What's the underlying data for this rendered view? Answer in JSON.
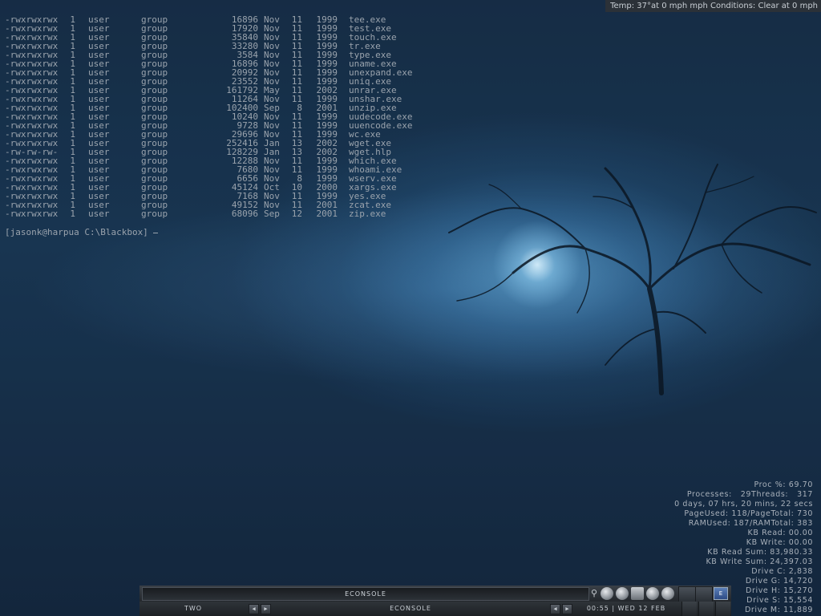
{
  "weather": {
    "text": "Temp: 37°at 0 mph mph Conditions: Clear at 0 mph"
  },
  "terminal": {
    "listing": [
      {
        "perm": "-rwxrwxrwx",
        "links": "1",
        "user": "user",
        "group": "group",
        "size": "16896",
        "month": "Nov",
        "day": "11",
        "year": "1999",
        "name": "tee.exe"
      },
      {
        "perm": "-rwxrwxrwx",
        "links": "1",
        "user": "user",
        "group": "group",
        "size": "17920",
        "month": "Nov",
        "day": "11",
        "year": "1999",
        "name": "test.exe"
      },
      {
        "perm": "-rwxrwxrwx",
        "links": "1",
        "user": "user",
        "group": "group",
        "size": "35840",
        "month": "Nov",
        "day": "11",
        "year": "1999",
        "name": "touch.exe"
      },
      {
        "perm": "-rwxrwxrwx",
        "links": "1",
        "user": "user",
        "group": "group",
        "size": "33280",
        "month": "Nov",
        "day": "11",
        "year": "1999",
        "name": "tr.exe"
      },
      {
        "perm": "-rwxrwxrwx",
        "links": "1",
        "user": "user",
        "group": "group",
        "size": "3584",
        "month": "Nov",
        "day": "11",
        "year": "1999",
        "name": "type.exe"
      },
      {
        "perm": "-rwxrwxrwx",
        "links": "1",
        "user": "user",
        "group": "group",
        "size": "16896",
        "month": "Nov",
        "day": "11",
        "year": "1999",
        "name": "uname.exe"
      },
      {
        "perm": "-rwxrwxrwx",
        "links": "1",
        "user": "user",
        "group": "group",
        "size": "20992",
        "month": "Nov",
        "day": "11",
        "year": "1999",
        "name": "unexpand.exe"
      },
      {
        "perm": "-rwxrwxrwx",
        "links": "1",
        "user": "user",
        "group": "group",
        "size": "23552",
        "month": "Nov",
        "day": "11",
        "year": "1999",
        "name": "uniq.exe"
      },
      {
        "perm": "-rwxrwxrwx",
        "links": "1",
        "user": "user",
        "group": "group",
        "size": "161792",
        "month": "May",
        "day": "11",
        "year": "2002",
        "name": "unrar.exe"
      },
      {
        "perm": "-rwxrwxrwx",
        "links": "1",
        "user": "user",
        "group": "group",
        "size": "11264",
        "month": "Nov",
        "day": "11",
        "year": "1999",
        "name": "unshar.exe"
      },
      {
        "perm": "-rwxrwxrwx",
        "links": "1",
        "user": "user",
        "group": "group",
        "size": "102400",
        "month": "Sep",
        "day": "8",
        "year": "2001",
        "name": "unzip.exe"
      },
      {
        "perm": "-rwxrwxrwx",
        "links": "1",
        "user": "user",
        "group": "group",
        "size": "10240",
        "month": "Nov",
        "day": "11",
        "year": "1999",
        "name": "uudecode.exe"
      },
      {
        "perm": "-rwxrwxrwx",
        "links": "1",
        "user": "user",
        "group": "group",
        "size": "9728",
        "month": "Nov",
        "day": "11",
        "year": "1999",
        "name": "uuencode.exe"
      },
      {
        "perm": "-rwxrwxrwx",
        "links": "1",
        "user": "user",
        "group": "group",
        "size": "29696",
        "month": "Nov",
        "day": "11",
        "year": "1999",
        "name": "wc.exe"
      },
      {
        "perm": "-rwxrwxrwx",
        "links": "1",
        "user": "user",
        "group": "group",
        "size": "252416",
        "month": "Jan",
        "day": "13",
        "year": "2002",
        "name": "wget.exe"
      },
      {
        "perm": "-rw-rw-rw-",
        "links": "1",
        "user": "user",
        "group": "group",
        "size": "128229",
        "month": "Jan",
        "day": "13",
        "year": "2002",
        "name": "wget.hlp"
      },
      {
        "perm": "-rwxrwxrwx",
        "links": "1",
        "user": "user",
        "group": "group",
        "size": "12288",
        "month": "Nov",
        "day": "11",
        "year": "1999",
        "name": "which.exe"
      },
      {
        "perm": "-rwxrwxrwx",
        "links": "1",
        "user": "user",
        "group": "group",
        "size": "7680",
        "month": "Nov",
        "day": "11",
        "year": "1999",
        "name": "whoami.exe"
      },
      {
        "perm": "-rwxrwxrwx",
        "links": "1",
        "user": "user",
        "group": "group",
        "size": "6656",
        "month": "Nov",
        "day": "8",
        "year": "1999",
        "name": "wserv.exe"
      },
      {
        "perm": "-rwxrwxrwx",
        "links": "1",
        "user": "user",
        "group": "group",
        "size": "45124",
        "month": "Oct",
        "day": "10",
        "year": "2000",
        "name": "xargs.exe"
      },
      {
        "perm": "-rwxrwxrwx",
        "links": "1",
        "user": "user",
        "group": "group",
        "size": "7168",
        "month": "Nov",
        "day": "11",
        "year": "1999",
        "name": "yes.exe"
      },
      {
        "perm": "-rwxrwxrwx",
        "links": "1",
        "user": "user",
        "group": "group",
        "size": "49152",
        "month": "Nov",
        "day": "11",
        "year": "2001",
        "name": "zcat.exe"
      },
      {
        "perm": "-rwxrwxrwx",
        "links": "1",
        "user": "user",
        "group": "group",
        "size": "68096",
        "month": "Sep",
        "day": "12",
        "year": "2001",
        "name": "zip.exe"
      }
    ],
    "prompt": "[jasonk@harpua C:\\Blackbox]"
  },
  "sysmon": {
    "lines": [
      "Proc %: 69.70",
      "Processes:   29Threads:   317",
      "0 days, 07 hrs, 20 mins, 22 secs",
      "PageUsed: 118/PageTotal: 730",
      "RAMUsed: 187/RAMTotal: 383",
      "KB Read: 00.00",
      "KB Write: 00.00",
      "KB Read Sum: 83,980.33",
      "KB Write Sum: 24,397.03",
      "Drive C: 2,838",
      "Drive G: 14,720",
      "Drive H: 15,270",
      "Drive S: 15,554",
      "Drive M: 11,889"
    ]
  },
  "taskbar": {
    "window_title": "ECONSOLE",
    "workspace": "TWO",
    "task": "ECONSOLE",
    "clock": "00:55 | WED 12 FEB",
    "ws_icon": "E",
    "tray_icons": [
      "pin-icon",
      "c-icon",
      "swirl-icon",
      "monitor-icon",
      "globe-icon",
      "brush-icon"
    ],
    "prev_arrow": "◀",
    "next_arrow": "▶"
  }
}
